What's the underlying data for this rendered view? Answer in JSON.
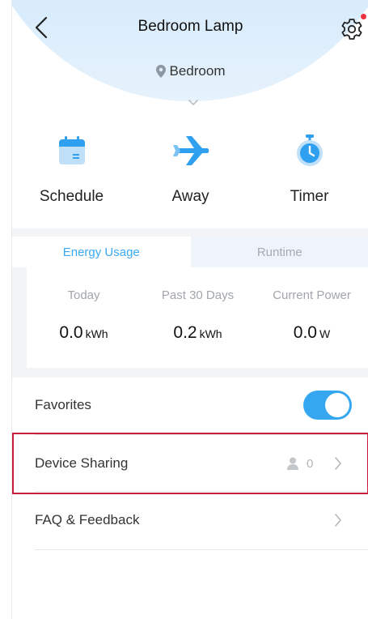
{
  "header": {
    "title": "Bedroom Lamp",
    "location": "Bedroom"
  },
  "actions": [
    {
      "label": "Schedule",
      "icon": "calendar-icon"
    },
    {
      "label": "Away",
      "icon": "airplane-icon"
    },
    {
      "label": "Timer",
      "icon": "stopwatch-icon"
    }
  ],
  "energy": {
    "tabs": [
      {
        "label": "Energy Usage",
        "active": true
      },
      {
        "label": "Runtime",
        "active": false
      }
    ],
    "stats": [
      {
        "caption": "Today",
        "value": "0.0",
        "unit": "kWh"
      },
      {
        "caption": "Past 30 Days",
        "value": "0.2",
        "unit": "kWh"
      },
      {
        "caption": "Current Power",
        "value": "0.0",
        "unit": "W"
      }
    ]
  },
  "list": {
    "favorites_label": "Favorites",
    "favorites_on": true,
    "device_sharing_label": "Device Sharing",
    "device_sharing_count": "0",
    "faq_label": "FAQ & Feedback"
  },
  "colors": {
    "accent": "#35a7f1",
    "highlight": "#c6203c",
    "notification": "#ef3340"
  }
}
